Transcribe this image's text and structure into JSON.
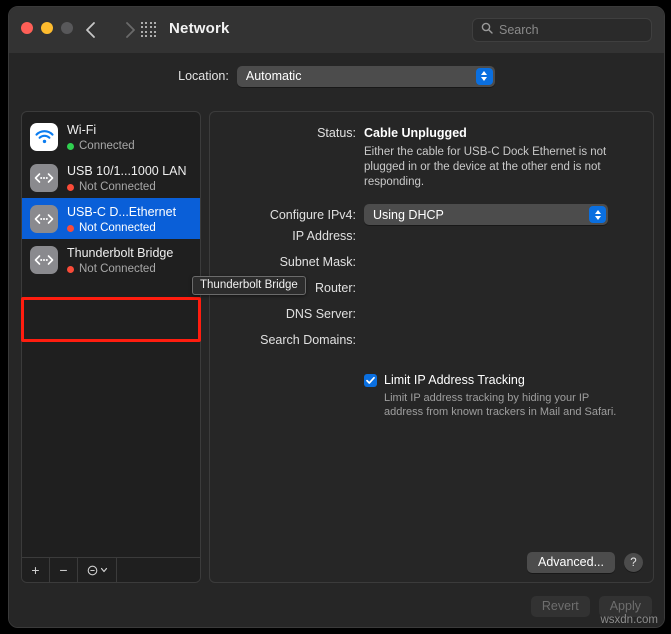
{
  "window": {
    "title": "Network",
    "traffic_lights": [
      "close",
      "minimize",
      "zoom"
    ],
    "back_label": "Back",
    "forward_label": "Forward",
    "grid_label": "Show All"
  },
  "search": {
    "placeholder": "Search",
    "value": ""
  },
  "location": {
    "label": "Location:",
    "value": "Automatic"
  },
  "sidebar": {
    "interfaces": [
      {
        "name": "Wi-Fi",
        "status": "Connected",
        "status_color": "#2fd04f",
        "icon": "wifi-icon",
        "selected": false
      },
      {
        "name": "USB 10/1...1000 LAN",
        "status": "Not Connected",
        "status_color": "#fa4b38",
        "icon": "ethernet-icon",
        "selected": false
      },
      {
        "name": "USB-C D...Ethernet",
        "status": "Not Connected",
        "status_color": "#fa4b38",
        "icon": "ethernet-icon",
        "selected": true
      },
      {
        "name": "Thunderbolt Bridge",
        "status": "Not Connected",
        "status_color": "#fa4b38",
        "icon": "ethernet-icon",
        "selected": false
      }
    ],
    "footer": {
      "add_label": "+",
      "remove_label": "−",
      "action_label": "⊙"
    }
  },
  "detail": {
    "status_label": "Status:",
    "status_value": "Cable Unplugged",
    "status_description": "Either the cable for USB-C Dock Ethernet is not plugged in or the device at the other end is not responding.",
    "configure_label": "Configure IPv4:",
    "configure_value": "Using DHCP",
    "fields": [
      {
        "label": "IP Address:",
        "value": ""
      },
      {
        "label": "Subnet Mask:",
        "value": ""
      },
      {
        "label": "Router:",
        "value": ""
      },
      {
        "label": "DNS Server:",
        "value": ""
      },
      {
        "label": "Search Domains:",
        "value": ""
      }
    ],
    "limit_tracking": {
      "checked": true,
      "label": "Limit IP Address Tracking",
      "description": "Limit IP address tracking by hiding your IP address from known trackers in Mail and Safari."
    },
    "advanced_label": "Advanced...",
    "help_label": "?"
  },
  "actions": {
    "revert_label": "Revert",
    "apply_label": "Apply",
    "revert_enabled": false,
    "apply_enabled": false
  },
  "tooltip": {
    "text": "Thunderbolt Bridge"
  },
  "watermark": {
    "text": "wsxdn.com"
  },
  "colors": {
    "accent": "#0a6fe0",
    "selection": "#0a5fd8",
    "highlight": "#ff1d0f",
    "connected": "#2fd04f",
    "disconnected": "#fa4b38"
  }
}
